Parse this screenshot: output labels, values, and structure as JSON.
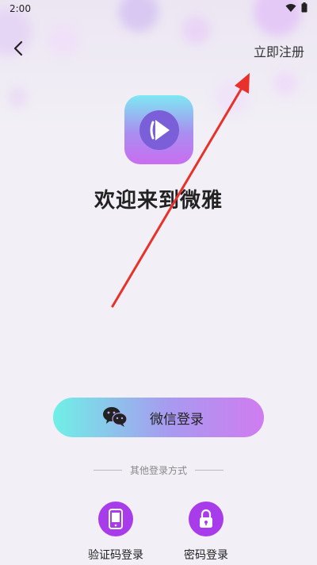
{
  "status_bar": {
    "time": "2:00"
  },
  "header": {
    "register_label": "立即注册"
  },
  "welcome": {
    "title": "欢迎来到微雅"
  },
  "wechat_login": {
    "label": "微信登录"
  },
  "divider": {
    "text": "其他登录方式"
  },
  "alt_logins": [
    {
      "label": "验证码登录",
      "icon": "phone-icon"
    },
    {
      "label": "密码登录",
      "icon": "lock-icon"
    }
  ],
  "colors": {
    "accent_purple": "#a93cea",
    "arrow_red": "#e8312a",
    "button_gradient_start": "#6ff0e6",
    "button_gradient_end": "#d07cf0"
  }
}
